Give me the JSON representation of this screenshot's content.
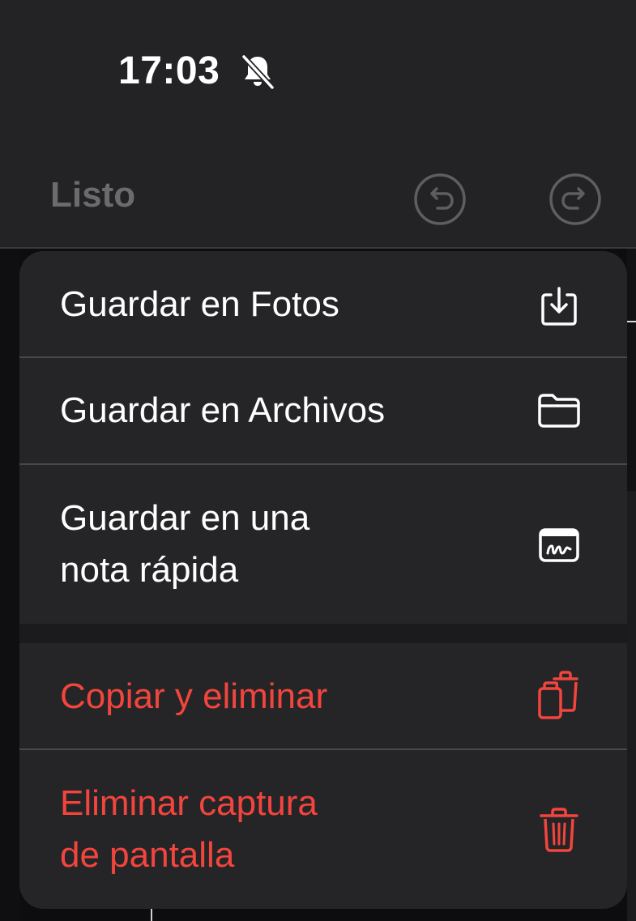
{
  "status_bar": {
    "time": "17:03",
    "silent_icon": "bell-slash-icon"
  },
  "toolbar": {
    "done_label": "Listo",
    "undo_icon": "undo-icon",
    "redo_icon": "redo-icon"
  },
  "menu": {
    "items": [
      {
        "label": "Guardar en Fotos",
        "icon": "save-to-photos-icon",
        "destructive": false
      },
      {
        "label": "Guardar en Archivos",
        "icon": "folder-icon",
        "destructive": false
      },
      {
        "label": "Guardar en una\nnota rápida",
        "icon": "quick-note-icon",
        "destructive": false
      },
      {
        "label": "Copiar y eliminar",
        "icon": "copy-delete-icon",
        "destructive": true
      },
      {
        "label": "Eliminar captura\nde pantalla",
        "icon": "trash-icon",
        "destructive": true
      }
    ]
  },
  "colors": {
    "destructive": "#f2453d",
    "menu_background": "#252527",
    "topbar_background": "#232325"
  }
}
